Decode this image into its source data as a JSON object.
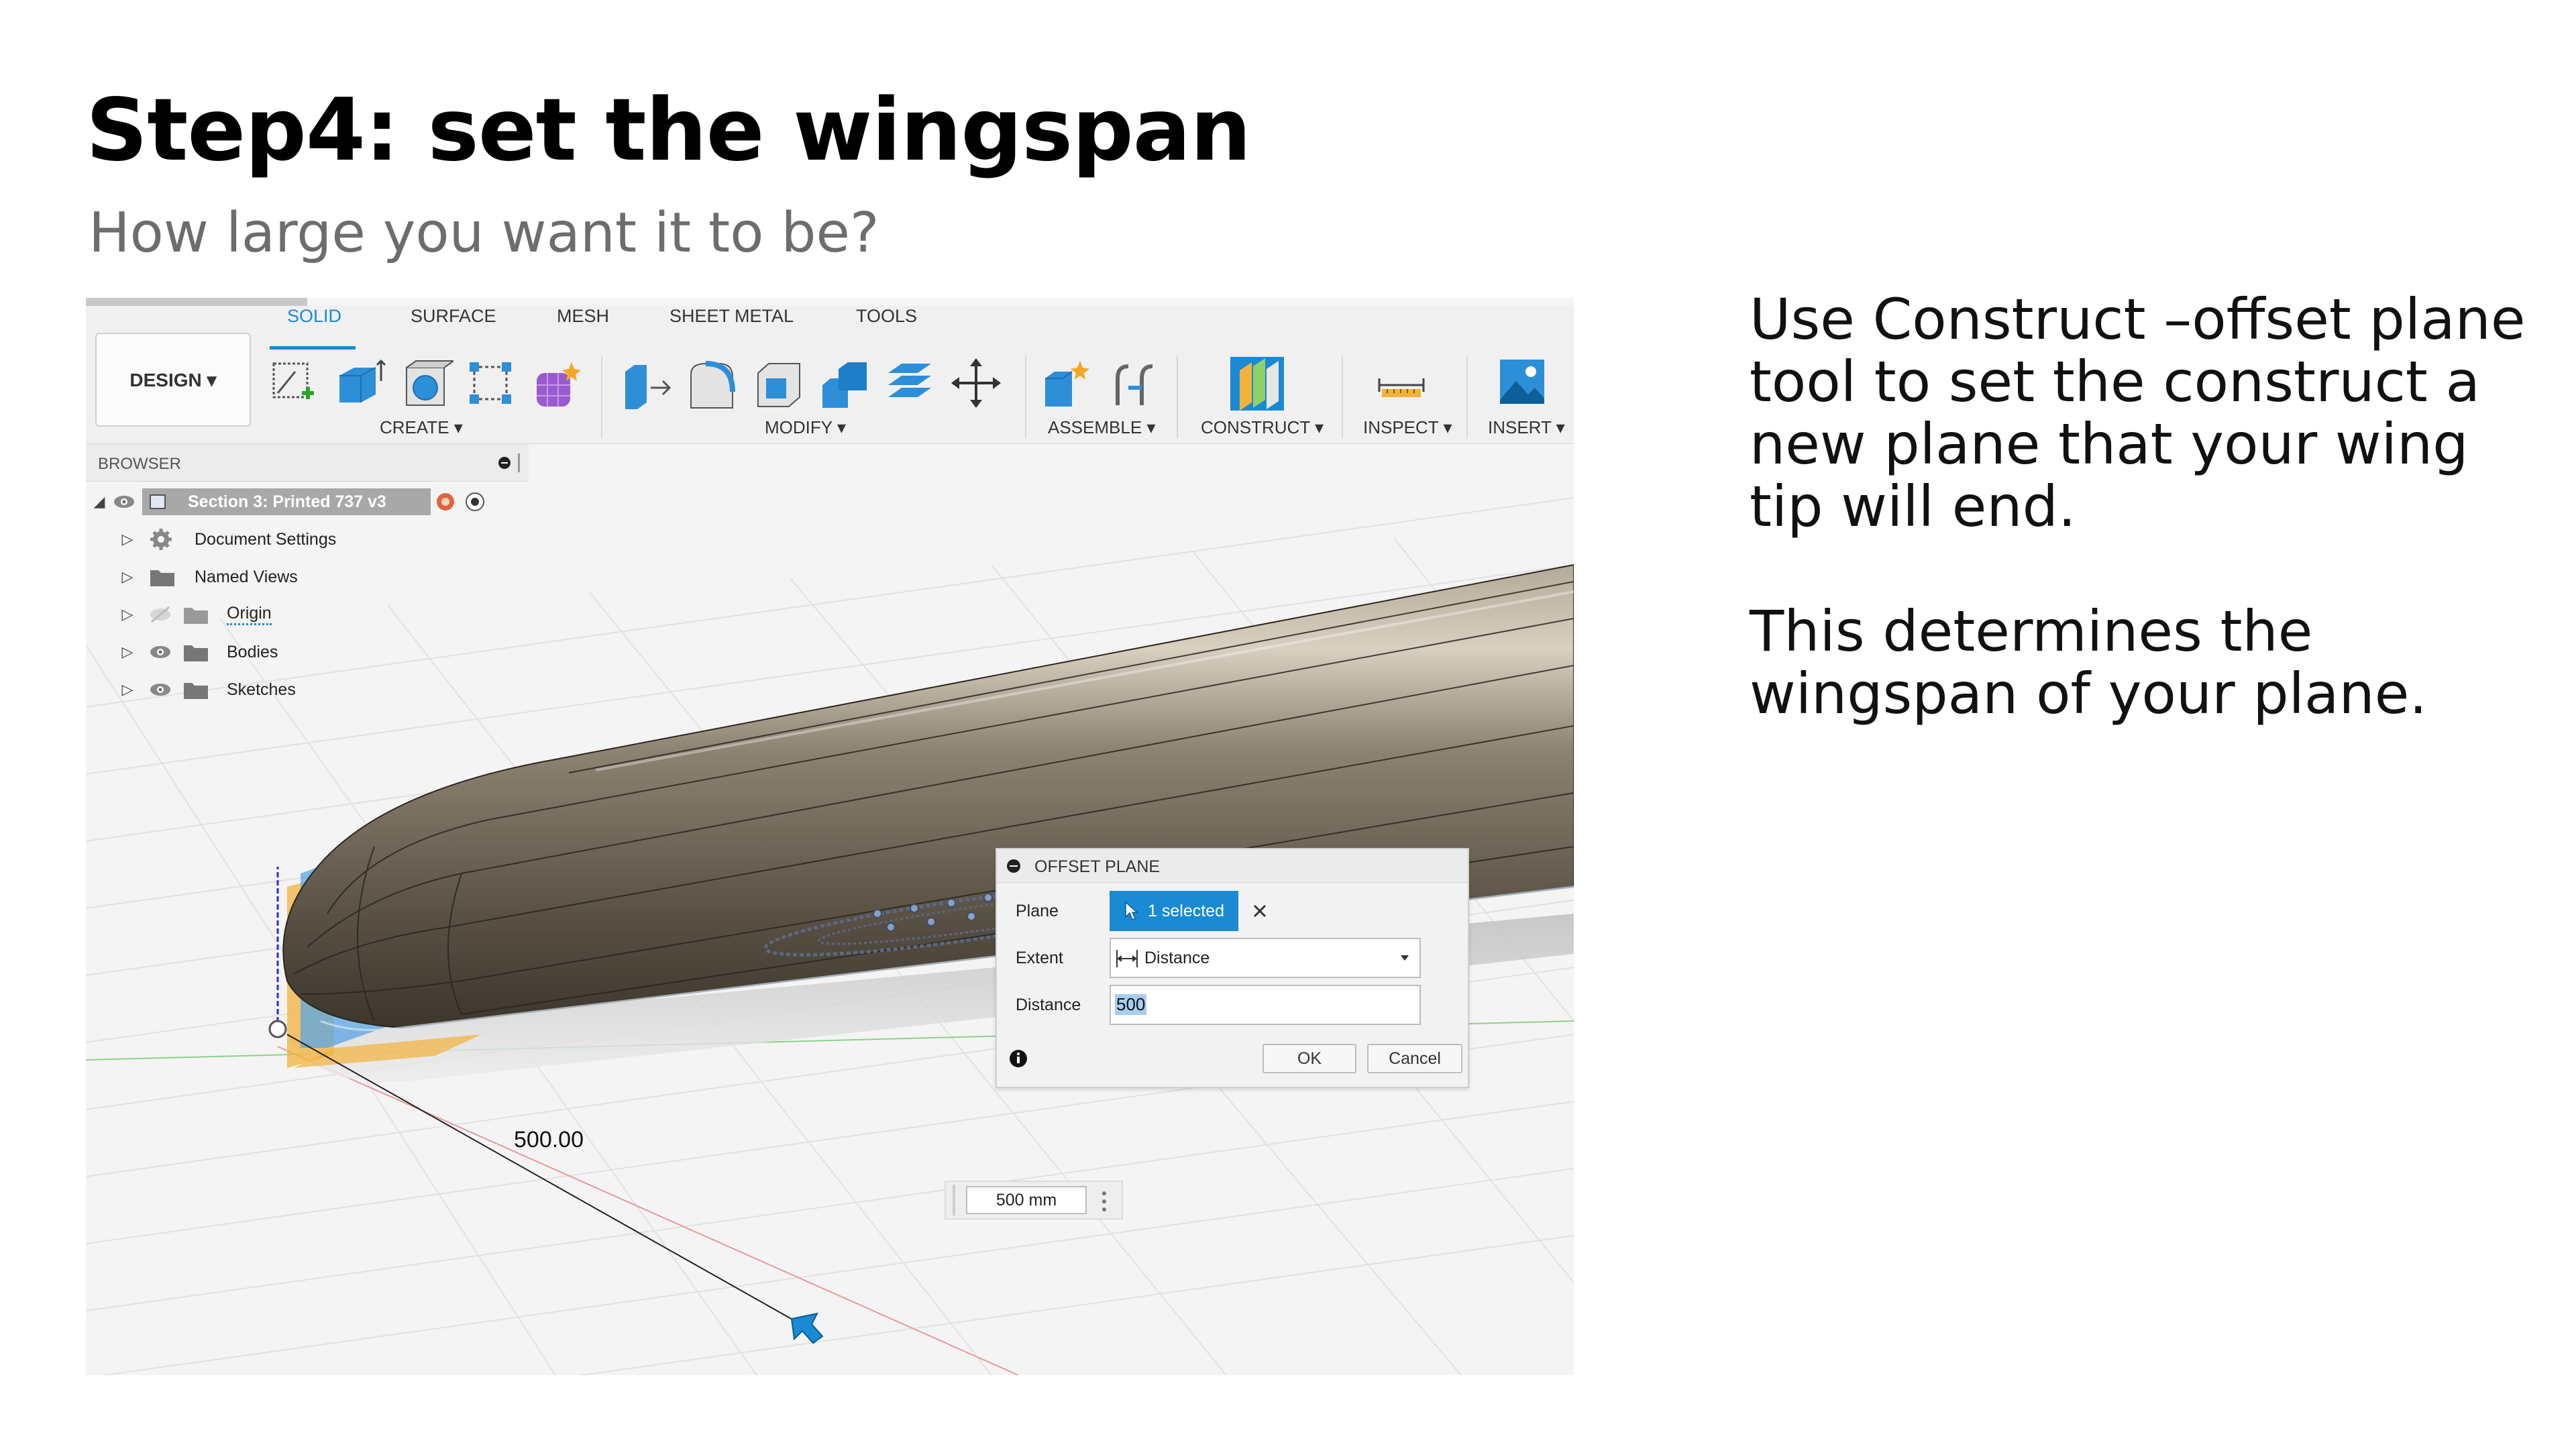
{
  "slide": {
    "title": "Step4: set the wingspan",
    "subtitle": "How large you want it to be?",
    "body_p1": "Use Construct –offset plane tool to set the construct a new plane that your wing tip will end.",
    "body_p2": "This determines the wingspan of your plane."
  },
  "toolbar": {
    "workspace": "DESIGN ▾",
    "tabs": [
      "SOLID",
      "SURFACE",
      "MESH",
      "SHEET METAL",
      "TOOLS"
    ],
    "groups": [
      "CREATE ▾",
      "MODIFY ▾",
      "ASSEMBLE ▾",
      "CONSTRUCT ▾",
      "INSPECT ▾",
      "INSERT ▾"
    ]
  },
  "browser": {
    "title": "BROWSER",
    "root": "Section 3: Printed 737 v3",
    "items": [
      "Document Settings",
      "Named Views",
      "Origin",
      "Bodies",
      "Sketches"
    ]
  },
  "viewport": {
    "dimension_label": "500.00",
    "measure_value": "500 mm"
  },
  "dialog": {
    "title": "OFFSET PLANE",
    "plane_label": "Plane",
    "plane_value": "1 selected",
    "extent_label": "Extent",
    "extent_value": "Distance",
    "distance_label": "Distance",
    "distance_value": "500",
    "ok_label": "OK",
    "cancel_label": "Cancel"
  },
  "colors": {
    "accent": "#1a8ad4",
    "body_color": "#6e6659",
    "plane_orange": "#f3b23c",
    "plane_blue": "#5aa6e6"
  }
}
